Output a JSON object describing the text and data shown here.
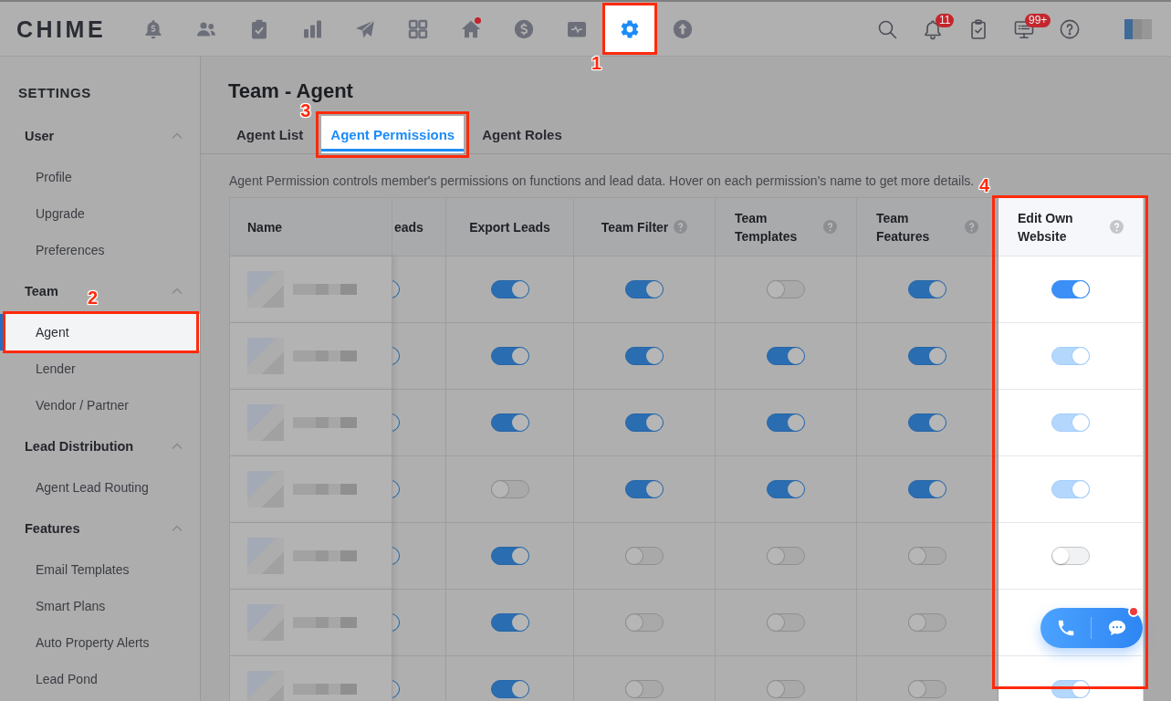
{
  "top_nav": {
    "logo": "CHIME",
    "items": [
      {
        "selected": false,
        "alert": false
      },
      {
        "selected": false,
        "alert": false
      },
      {
        "selected": false,
        "alert": false
      },
      {
        "selected": false,
        "alert": false
      },
      {
        "selected": false,
        "alert": false
      },
      {
        "selected": false,
        "alert": false
      },
      {
        "selected": false,
        "alert": true
      },
      {
        "selected": false,
        "alert": false
      },
      {
        "selected": false,
        "alert": false
      },
      {
        "selected": true,
        "alert": false,
        "callout": "1"
      },
      {
        "selected": false,
        "alert": false
      }
    ],
    "notification_badge": "11",
    "message_badge": "99+"
  },
  "sidebar": {
    "title": "SETTINGS",
    "sections": [
      {
        "label": "User",
        "expanded": true,
        "items": [
          {
            "label": "Profile",
            "selected": false
          },
          {
            "label": "Upgrade",
            "selected": false
          },
          {
            "label": "Preferences",
            "selected": false
          }
        ]
      },
      {
        "label": "Team",
        "expanded": true,
        "items": [
          {
            "label": "Agent",
            "selected": true,
            "callout": "2"
          },
          {
            "label": "Lender",
            "selected": false
          },
          {
            "label": "Vendor / Partner",
            "selected": false
          }
        ]
      },
      {
        "label": "Lead Distribution",
        "expanded": true,
        "items": [
          {
            "label": "Agent Lead Routing",
            "selected": false
          }
        ]
      },
      {
        "label": "Features",
        "expanded": true,
        "items": [
          {
            "label": "Email Templates",
            "selected": false
          },
          {
            "label": "Smart Plans",
            "selected": false
          },
          {
            "label": "Auto Property Alerts",
            "selected": false
          },
          {
            "label": "Lead Pond",
            "selected": false
          }
        ]
      }
    ]
  },
  "page": {
    "title": "Team - Agent",
    "tabs": [
      {
        "label": "Agent List",
        "selected": false
      },
      {
        "label": "Agent Permissions",
        "selected": true,
        "callout": "3"
      },
      {
        "label": "Agent Roles",
        "selected": false
      }
    ],
    "description": "Agent Permission controls member's permissions on functions and lead data. Hover on each permission's name to get more details."
  },
  "table": {
    "columns": [
      {
        "label": "Name",
        "help": false
      },
      {
        "label": "eads",
        "help": false
      },
      {
        "label": "Export Leads",
        "help": false
      },
      {
        "label": "Team Filter",
        "help": true
      },
      {
        "label": "Team Templates",
        "help": true
      },
      {
        "label": "Team Features",
        "help": true
      },
      {
        "label": "Edit Own Website",
        "help": true,
        "callout": "4"
      }
    ],
    "rows": [
      {
        "cells": [
          {
            "on": true,
            "disabled": false
          },
          {
            "on": true,
            "disabled": false
          },
          {
            "on": true,
            "disabled": false
          },
          {
            "on": false,
            "disabled": false
          },
          {
            "on": true,
            "disabled": false
          },
          {
            "on": true,
            "disabled": false
          }
        ]
      },
      {
        "cells": [
          {
            "on": true,
            "disabled": false
          },
          {
            "on": true,
            "disabled": false
          },
          {
            "on": true,
            "disabled": false
          },
          {
            "on": true,
            "disabled": false
          },
          {
            "on": true,
            "disabled": false
          },
          {
            "on": true,
            "disabled": true
          }
        ]
      },
      {
        "cells": [
          {
            "on": true,
            "disabled": false
          },
          {
            "on": true,
            "disabled": false
          },
          {
            "on": true,
            "disabled": false
          },
          {
            "on": true,
            "disabled": false
          },
          {
            "on": true,
            "disabled": false
          },
          {
            "on": true,
            "disabled": true
          }
        ]
      },
      {
        "cells": [
          {
            "on": true,
            "disabled": false
          },
          {
            "on": false,
            "disabled": false
          },
          {
            "on": true,
            "disabled": false
          },
          {
            "on": true,
            "disabled": false
          },
          {
            "on": true,
            "disabled": false
          },
          {
            "on": true,
            "disabled": true
          }
        ]
      },
      {
        "cells": [
          {
            "on": true,
            "disabled": false
          },
          {
            "on": true,
            "disabled": false
          },
          {
            "on": false,
            "disabled": false
          },
          {
            "on": false,
            "disabled": false
          },
          {
            "on": false,
            "disabled": false
          },
          {
            "on": false,
            "disabled": false
          }
        ]
      },
      {
        "cells": [
          {
            "on": true,
            "disabled": false
          },
          {
            "on": true,
            "disabled": false
          },
          {
            "on": false,
            "disabled": false
          },
          {
            "on": false,
            "disabled": false
          },
          {
            "on": false,
            "disabled": false
          }
        ]
      },
      {
        "cells": [
          {
            "on": true,
            "disabled": false
          },
          {
            "on": true,
            "disabled": false
          },
          {
            "on": false,
            "disabled": false
          },
          {
            "on": false,
            "disabled": false
          },
          {
            "on": false,
            "disabled": false
          },
          {
            "on": true,
            "disabled": true
          }
        ]
      }
    ]
  },
  "chat_widget": {
    "unread": true
  }
}
